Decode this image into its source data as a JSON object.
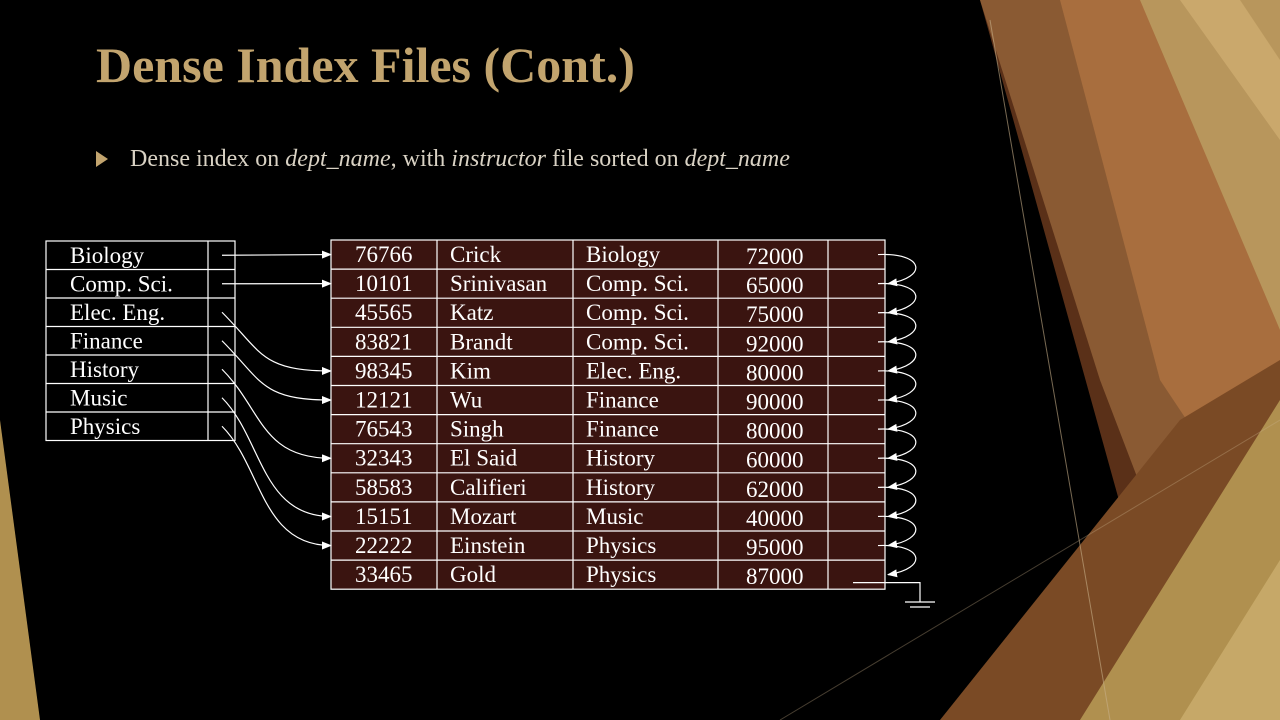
{
  "slide": {
    "title": "Dense Index Files (Cont.)",
    "bullet": {
      "icon": "triangle-bullet-icon",
      "parts": [
        {
          "text": "Dense index on ",
          "italic": false
        },
        {
          "text": "dept_name",
          "italic": true
        },
        {
          "text": ", with ",
          "italic": false
        },
        {
          "text": "instructor",
          "italic": true
        },
        {
          "text": " file sorted on ",
          "italic": false
        },
        {
          "text": "dept_name",
          "italic": true
        }
      ]
    }
  },
  "colors": {
    "title": "#c2a46e",
    "table_fill": "#3a1410",
    "lines": "#ffffff"
  },
  "index": [
    "Biology",
    "Comp. Sci.",
    "Elec. Eng.",
    "Finance",
    "History",
    "Music",
    "Physics"
  ],
  "index_pointer_targets": [
    0,
    1,
    4,
    5,
    7,
    9,
    10
  ],
  "records": [
    {
      "id": "76766",
      "name": "Crick",
      "dept": "Biology",
      "salary": "72000"
    },
    {
      "id": "10101",
      "name": "Srinivasan",
      "dept": "Comp. Sci.",
      "salary": "65000"
    },
    {
      "id": "45565",
      "name": "Katz",
      "dept": "Comp. Sci.",
      "salary": "75000"
    },
    {
      "id": "83821",
      "name": "Brandt",
      "dept": "Comp. Sci.",
      "salary": "92000"
    },
    {
      "id": "98345",
      "name": "Kim",
      "dept": "Elec. Eng.",
      "salary": "80000"
    },
    {
      "id": "12121",
      "name": "Wu",
      "dept": "Finance",
      "salary": "90000"
    },
    {
      "id": "76543",
      "name": "Singh",
      "dept": "Finance",
      "salary": "80000"
    },
    {
      "id": "32343",
      "name": "El Said",
      "dept": "History",
      "salary": "60000"
    },
    {
      "id": "58583",
      "name": "Califieri",
      "dept": "History",
      "salary": "62000"
    },
    {
      "id": "15151",
      "name": "Mozart",
      "dept": "Music",
      "salary": "40000"
    },
    {
      "id": "22222",
      "name": "Einstein",
      "dept": "Physics",
      "salary": "95000"
    },
    {
      "id": "33465",
      "name": "Gold",
      "dept": "Physics",
      "salary": "87000"
    }
  ]
}
